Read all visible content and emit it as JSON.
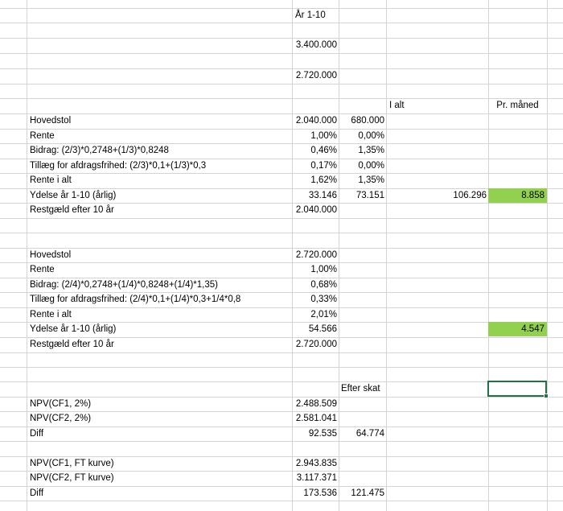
{
  "sheet": {
    "header": {
      "period": "År 1-10",
      "val_a": "3.400.000",
      "val_b": "2.720.000",
      "i_alt": "I alt",
      "pr_maaned": "Pr. måned"
    },
    "loan1": {
      "hovedstol_label": "Hovedstol",
      "hovedstol_b": "2.040.000",
      "hovedstol_c": "680.000",
      "rente_label": "Rente",
      "rente_b": "1,00%",
      "rente_c": "0,00%",
      "bidrag_label": "Bidrag: (2/3)*0,2748+(1/3)*0,8248",
      "bidrag_b": "0,46%",
      "bidrag_c": "1,35%",
      "tillaeg_label": "Tillæg for afdragsfrihed: (2/3)*0,1+(1/3)*0,3",
      "tillaeg_b": "0,17%",
      "tillaeg_c": "0,00%",
      "rente_ialt_label": "Rente i alt",
      "rente_ialt_b": "1,62%",
      "rente_ialt_c": "1,35%",
      "ydelse_label": "Ydelse år 1-10 (årlig)",
      "ydelse_b": "33.146",
      "ydelse_c": "73.151",
      "ydelse_d": "106.296",
      "ydelse_e": "8.858",
      "restgaeld_label": "Restgæld efter 10 år",
      "restgaeld_b": "2.040.000"
    },
    "loan2": {
      "hovedstol_label": "Hovedstol",
      "hovedstol_b": "2.720.000",
      "rente_label": "Rente",
      "rente_b": "1,00%",
      "bidrag_label": "Bidrag: (2/4)*0,2748+(1/4)*0,8248+(1/4)*1,35)",
      "bidrag_b": "0,68%",
      "tillaeg_label": "Tillæg for afdragsfrihed: (2/4)*0,1+(1/4)*0,3+1/4*0,8",
      "tillaeg_b": "0,33%",
      "rente_ialt_label": "Rente i alt",
      "rente_ialt_b": "2,01%",
      "ydelse_label": "Ydelse år 1-10 (årlig)",
      "ydelse_b": "54.566",
      "ydelse_e": "4.547",
      "restgaeld_label": "Restgæld efter 10 år",
      "restgaeld_b": "2.720.000"
    },
    "npv1": {
      "efter_skat": "Efter skat",
      "cf1_label": "NPV(CF1, 2%)",
      "cf1_b": "2.488.509",
      "cf2_label": "NPV(CF2, 2%)",
      "cf2_b": "2.581.041",
      "diff_label": "Diff",
      "diff_b": "92.535",
      "diff_c": "64.774"
    },
    "npv2": {
      "cf1_label": "NPV(CF1, FT kurve)",
      "cf1_b": "2.943.835",
      "cf2_label": "NPV(CF2, FT kurve)",
      "cf2_b": "3.117.371",
      "diff_label": "Diff",
      "diff_b": "173.536",
      "diff_c": "121.475"
    }
  },
  "colors": {
    "highlight": "#92d050",
    "selection": "#217346",
    "gridline": "#d4d4d4"
  }
}
